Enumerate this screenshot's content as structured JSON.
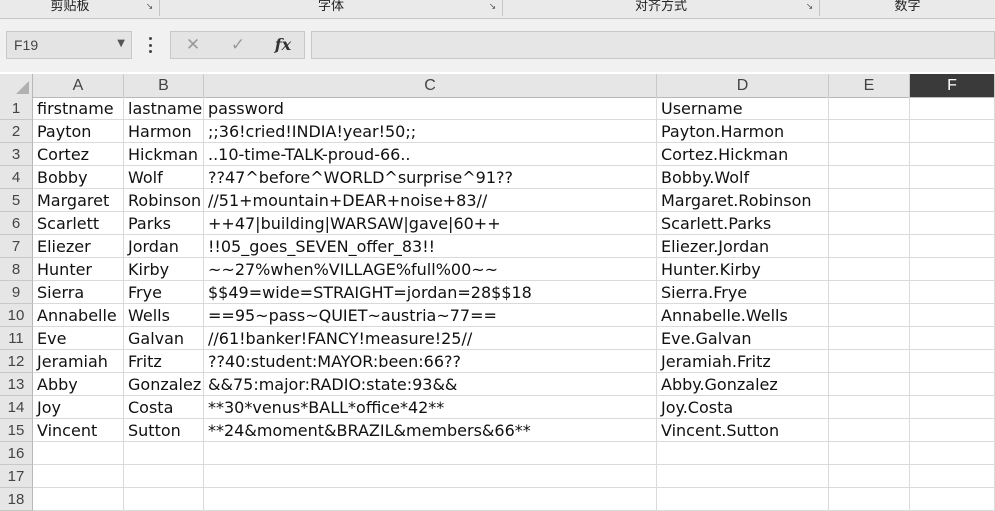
{
  "ribbon": {
    "groups": [
      {
        "label": "剪贴板"
      },
      {
        "label": "字体"
      },
      {
        "label": "对齐方式"
      },
      {
        "label": "数字"
      }
    ]
  },
  "formula_bar": {
    "name_box": "F19",
    "cancel_icon": "✕",
    "enter_icon": "✓",
    "function_label": "fx",
    "formula_value": ""
  },
  "sheet": {
    "columns": [
      "A",
      "B",
      "C",
      "D",
      "E",
      "F"
    ],
    "selected_column": "F",
    "rows": [
      {
        "num": "1",
        "A": "firstname",
        "B": "lastname",
        "C": "password",
        "D": "Username"
      },
      {
        "num": "2",
        "A": "Payton",
        "B": "Harmon",
        "C": ";;36!cried!INDIA!year!50;;",
        "D": "Payton.Harmon"
      },
      {
        "num": "3",
        "A": "Cortez",
        "B": "Hickman",
        "C": "..10-time-TALK-proud-66..",
        "D": "Cortez.Hickman"
      },
      {
        "num": "4",
        "A": "Bobby",
        "B": "Wolf",
        "C": "??47^before^WORLD^surprise^91??",
        "D": "Bobby.Wolf"
      },
      {
        "num": "5",
        "A": "Margaret",
        "B": "Robinson",
        "C": "//51+mountain+DEAR+noise+83//",
        "D": "Margaret.Robinson"
      },
      {
        "num": "6",
        "A": "Scarlett",
        "B": "Parks",
        "C": "++47|building|WARSAW|gave|60++",
        "D": "Scarlett.Parks"
      },
      {
        "num": "7",
        "A": "Eliezer",
        "B": "Jordan",
        "C": "!!05_goes_SEVEN_offer_83!!",
        "D": "Eliezer.Jordan"
      },
      {
        "num": "8",
        "A": "Hunter",
        "B": "Kirby",
        "C": "~~27%when%VILLAGE%full%00~~",
        "D": "Hunter.Kirby"
      },
      {
        "num": "9",
        "A": "Sierra",
        "B": "Frye",
        "C": "$$49=wide=STRAIGHT=jordan=28$$18",
        "D": "Sierra.Frye"
      },
      {
        "num": "10",
        "A": "Annabelle",
        "B": "Wells",
        "C": "==95~pass~QUIET~austria~77==",
        "D": "Annabelle.Wells"
      },
      {
        "num": "11",
        "A": "Eve",
        "B": "Galvan",
        "C": "//61!banker!FANCY!measure!25//",
        "D": "Eve.Galvan"
      },
      {
        "num": "12",
        "A": "Jeramiah",
        "B": "Fritz",
        "C": "??40:student:MAYOR:been:66??",
        "D": "Jeramiah.Fritz"
      },
      {
        "num": "13",
        "A": "Abby",
        "B": "Gonzalez",
        "C": "&&75:major:RADIO:state:93&&",
        "D": "Abby.Gonzalez"
      },
      {
        "num": "14",
        "A": "Joy",
        "B": "Costa",
        "C": "**30*venus*BALL*office*42**",
        "D": "Joy.Costa"
      },
      {
        "num": "15",
        "A": "Vincent",
        "B": "Sutton",
        "C": "**24&moment&BRAZIL&members&66**",
        "D": "Vincent.Sutton"
      },
      {
        "num": "16",
        "A": "",
        "B": "",
        "C": "",
        "D": ""
      },
      {
        "num": "17",
        "A": "",
        "B": "",
        "C": "",
        "D": ""
      },
      {
        "num": "18",
        "A": "",
        "B": "",
        "C": "",
        "D": ""
      }
    ]
  },
  "colors": {
    "selected_header_bg": "#3a3a3a",
    "header_bg": "#e6e6e6",
    "gridline": "#dadada"
  }
}
